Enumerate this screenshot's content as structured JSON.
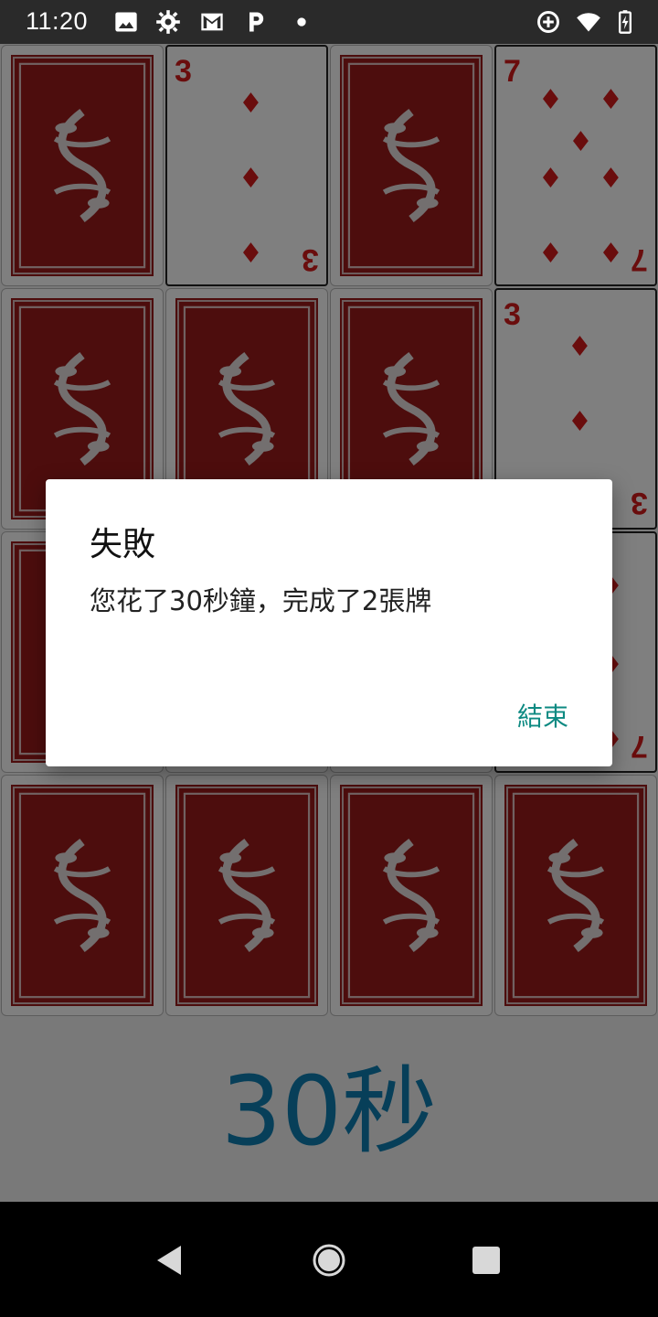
{
  "status_bar": {
    "time": "11:20",
    "left_icons": [
      "image-icon",
      "gear-icon",
      "gmail-icon",
      "p-icon",
      "dot-icon"
    ],
    "right_icons": [
      "data-saver-icon",
      "wifi-icon",
      "battery-icon"
    ]
  },
  "game": {
    "cards": [
      {
        "face": "back"
      },
      {
        "face": "up",
        "rank": "3",
        "suit": "diamonds"
      },
      {
        "face": "back"
      },
      {
        "face": "up",
        "rank": "7",
        "suit": "diamonds"
      },
      {
        "face": "back"
      },
      {
        "face": "back"
      },
      {
        "face": "back"
      },
      {
        "face": "up",
        "rank": "3",
        "suit": "diamonds"
      },
      {
        "face": "back"
      },
      {
        "face": "back"
      },
      {
        "face": "back"
      },
      {
        "face": "up",
        "rank": "7",
        "suit": "diamonds"
      },
      {
        "face": "back"
      },
      {
        "face": "back"
      },
      {
        "face": "back"
      },
      {
        "face": "back"
      }
    ],
    "timer": "30秒",
    "colors": {
      "card_back": "#9b1b1b",
      "suit_red": "#d41a1a",
      "timer": "#0e7fb2"
    }
  },
  "dialog": {
    "title": "失敗",
    "message": "您花了30秒鐘，完成了2張牌",
    "button_label": "結束",
    "button_color": "#0d8a82"
  },
  "nav_bar": {
    "buttons": [
      "back-icon",
      "home-icon",
      "recents-icon"
    ]
  }
}
